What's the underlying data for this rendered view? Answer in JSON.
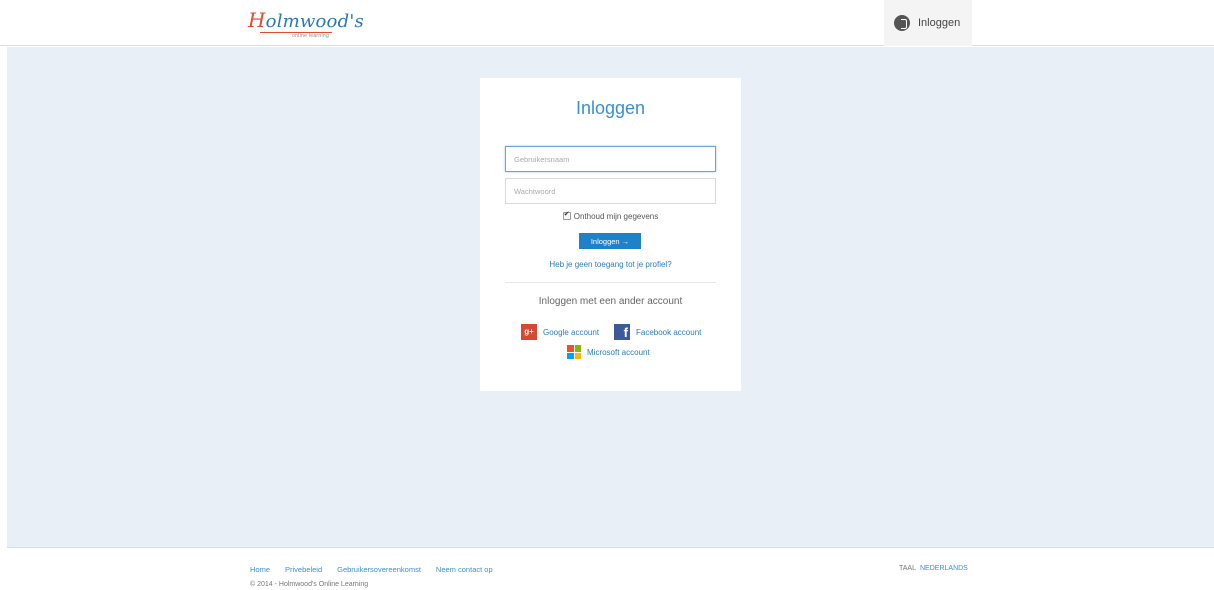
{
  "header": {
    "logo_text_h": "H",
    "logo_text_rest": "olmwood's",
    "logo_sub": "online learning",
    "login_label": "Inloggen"
  },
  "card": {
    "title": "Inloggen",
    "username_placeholder": "Gebruikersnaam",
    "password_placeholder": "Wachtwoord",
    "remember_label": "Onthoud mijn gegevens",
    "remember_checked": true,
    "submit_label": "Inloggen →",
    "forgot_label": "Heb je geen toegang tot je profiel?",
    "alt_title": "Inloggen met een ander account",
    "social": {
      "google": {
        "icon": "g+",
        "label": "Google account"
      },
      "facebook": {
        "icon": "f",
        "label": "Facebook account"
      },
      "microsoft": {
        "label": "Microsoft account"
      }
    }
  },
  "footer": {
    "links": [
      "Home",
      "Privebeleid",
      "Gebruikersovereenkomst",
      "Neem contact op"
    ],
    "copyright": "© 2014 - Holmwood's Online Learning",
    "lang_label": "TAAL",
    "lang_value": "NEDERLANDS"
  },
  "colors": {
    "accent": "#3a8fd1",
    "button": "#1f82c8",
    "background": "#e8eff7",
    "google": "#d8472f",
    "facebook": "#3b5a99"
  }
}
